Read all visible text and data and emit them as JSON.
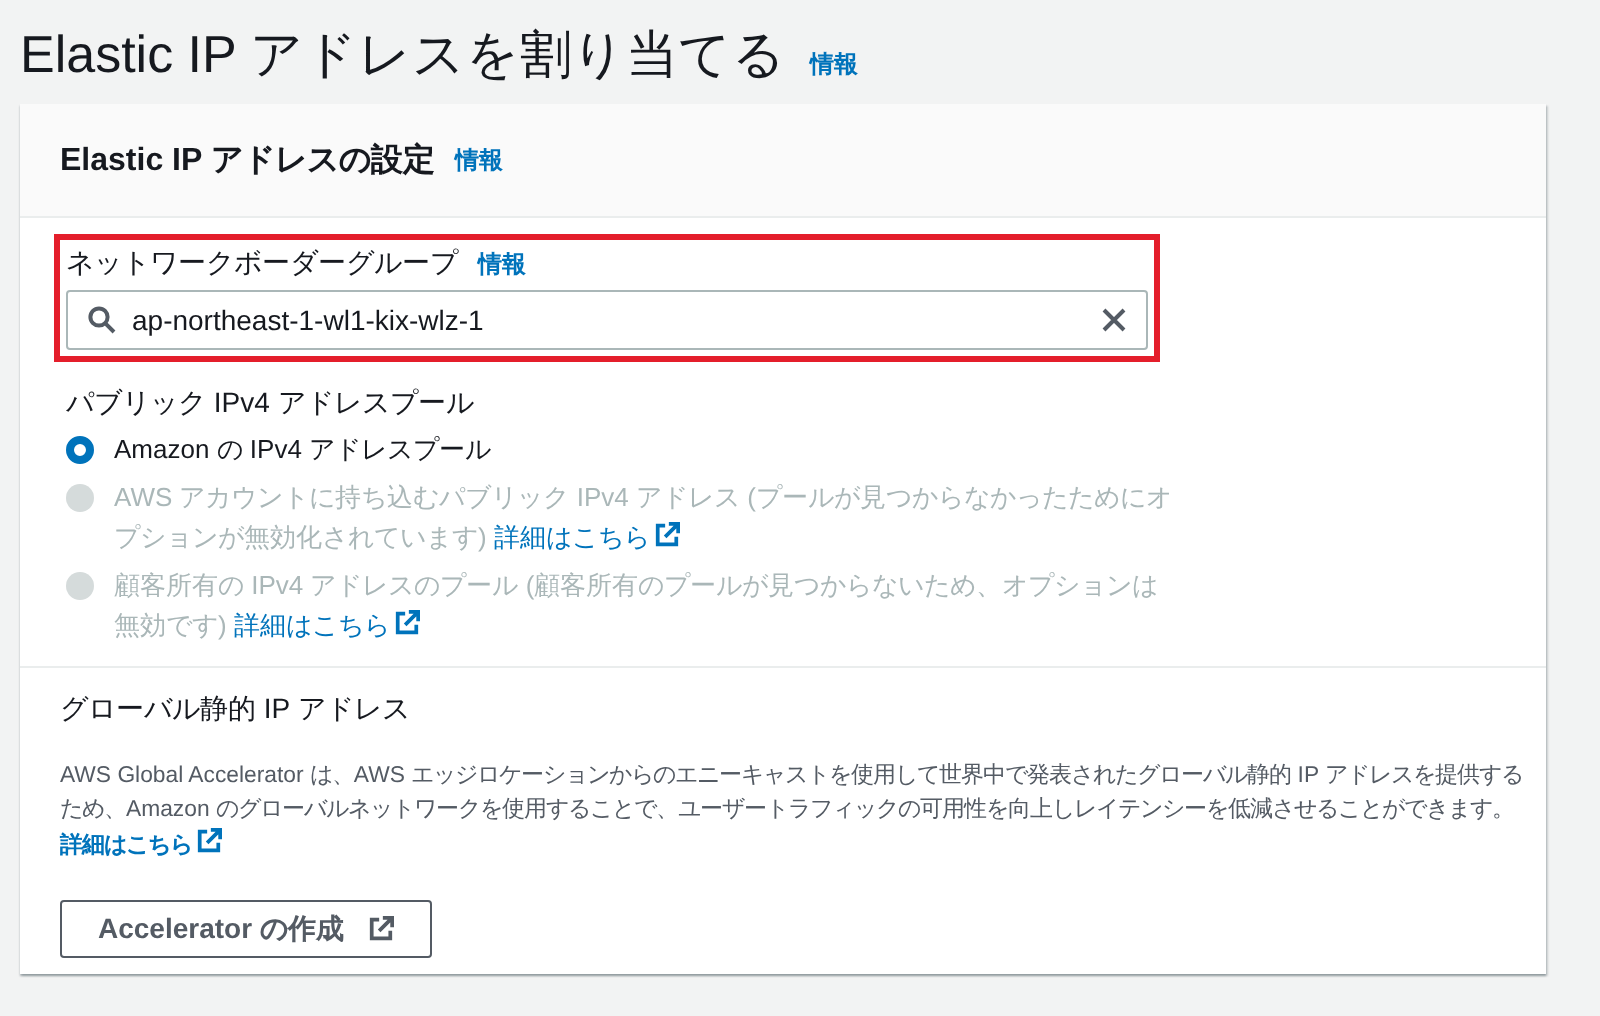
{
  "page": {
    "title": "Elastic IP アドレスを割り当てる",
    "info_link": "情報"
  },
  "card": {
    "title": "Elastic IP アドレスの設定",
    "info_link": "情報",
    "network_border_group": {
      "label": "ネットワークボーダーグループ",
      "info_link": "情報",
      "value": "ap-northeast-1-wl1-kix-wlz-1",
      "highlighted": true
    },
    "pool": {
      "label": "パブリック IPv4 アドレスプール",
      "options": [
        {
          "text": "Amazon の IPv4 アドレスプール",
          "selected": true,
          "disabled": false
        },
        {
          "text": "AWS アカウントに持ち込むパブリック IPv4 アドレス (プールが見つからなかったためにオプションが無効化されています)",
          "link": "詳細はこちら",
          "selected": false,
          "disabled": true
        },
        {
          "text": "顧客所有の IPv4 アドレスのプール (顧客所有のプールが見つからないため、オプションは無効です)",
          "link": "詳細はこちら",
          "selected": false,
          "disabled": true
        }
      ]
    },
    "global_ip": {
      "label": "グローバル静的 IP アドレス",
      "description": "AWS Global Accelerator は、AWS エッジロケーションからのエニーキャストを使用して世界中で発表されたグローバル静的 IP アドレスを提供するため、Amazon のグローバルネットワークを使用することで、ユーザートラフィックの可用性を向上しレイテンシーを低減させることができます。",
      "link": "詳細はこちら",
      "button": "Accelerator の作成"
    }
  }
}
